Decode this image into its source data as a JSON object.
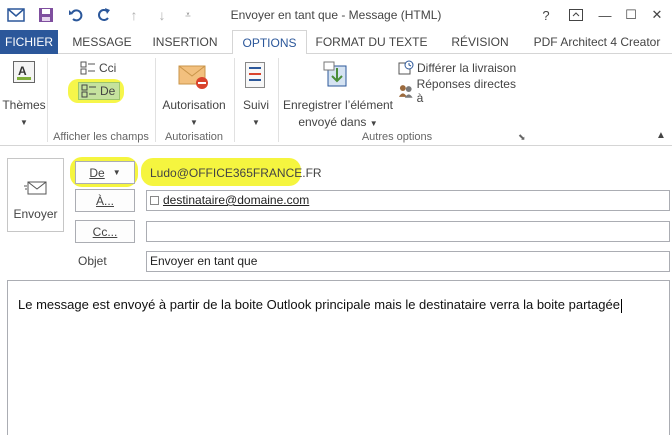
{
  "title_bar": {
    "title": "Envoyer en tant que - Message (HTML)",
    "help": "?",
    "restore": "⧉",
    "minimize": "—",
    "maximize": "☐",
    "close": "✕"
  },
  "tabs": [
    "FICHIER",
    "MESSAGE",
    "INSERTION",
    "OPTIONS",
    "FORMAT DU TEXTE",
    "RÉVISION",
    "PDF Architect 4 Creator"
  ],
  "active_tab": "OPTIONS",
  "ribbon": {
    "themes": {
      "label": "Thèmes"
    },
    "afficher_champs": {
      "cci": "Cci",
      "de": "De",
      "group_label": "Afficher les champs"
    },
    "autorisation": {
      "label": "Autorisation",
      "group_label": "Autorisation"
    },
    "suivi": {
      "label": "Suivi"
    },
    "enregistrer": {
      "label_line1": "Enregistrer l’élément",
      "label_line2": "envoyé dans"
    },
    "differer": {
      "label": "Différer la livraison"
    },
    "reponses": {
      "label": "Réponses directes à"
    },
    "autres_options": {
      "group_label": "Autres options"
    }
  },
  "compose": {
    "send_label": "Envoyer",
    "from_button": "De",
    "from_value": "Ludo@OFFICE365FRANCE.FR",
    "to_button": "À...",
    "to_value": "destinataire@domaine.com",
    "cc_button": "Cc...",
    "cc_value": "",
    "subject_label": "Objet",
    "subject_value": "Envoyer en tant que",
    "body": "Le message est envoyé à partir de la boite Outlook principale mais le destinataire verra la boite partagée"
  },
  "colors": {
    "accent": "#2b579a",
    "highlight": "#f7f718"
  }
}
